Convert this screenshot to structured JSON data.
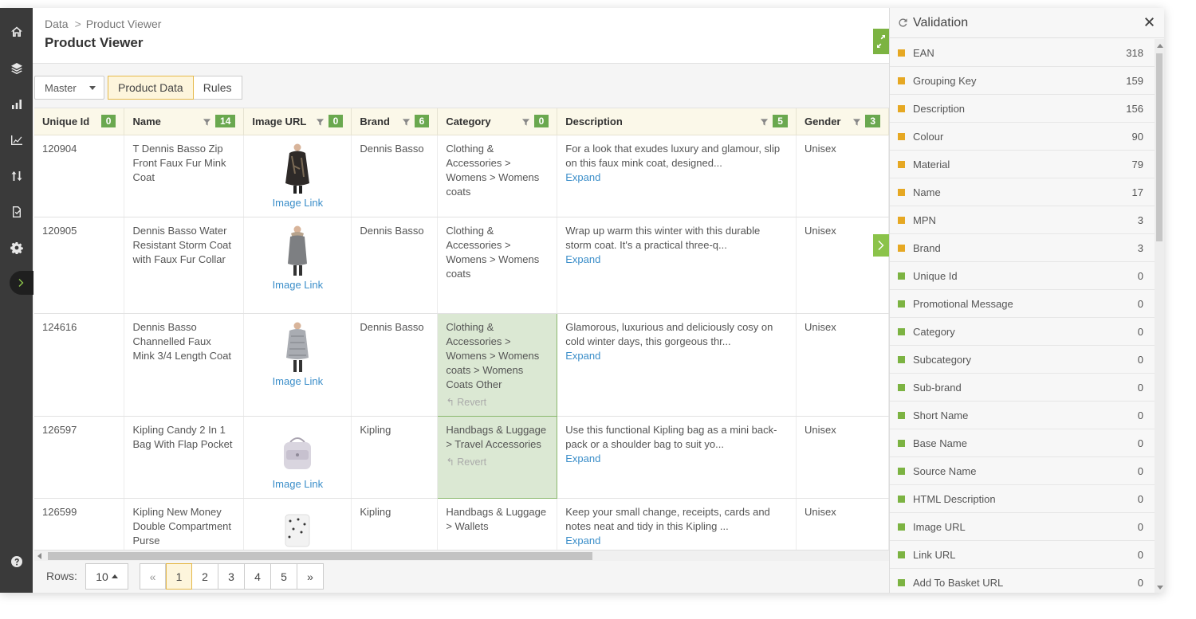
{
  "nav_icons": [
    "home-icon",
    "layers-icon",
    "bar-chart-icon",
    "area-chart-icon",
    "transfer-icon",
    "checklist-icon",
    "gear-icon",
    "chevron-right-icon",
    "help-icon"
  ],
  "breadcrumb": {
    "root": "Data",
    "separator": ">",
    "current": "Product Viewer"
  },
  "page_title": "Product Viewer",
  "toolbar": {
    "view_select": "Master",
    "tabs": [
      {
        "label": "Product Data",
        "active": true
      },
      {
        "label": "Rules",
        "active": false
      }
    ]
  },
  "grid": {
    "columns": [
      {
        "label": "Unique Id",
        "count": "0",
        "filter": false
      },
      {
        "label": "Name",
        "count": "14",
        "filter": true
      },
      {
        "label": "Image URL",
        "count": "0",
        "filter": true
      },
      {
        "label": "Brand",
        "count": "6",
        "filter": true
      },
      {
        "label": "Category",
        "count": "0",
        "filter": true
      },
      {
        "label": "Description",
        "count": "5",
        "filter": true
      },
      {
        "label": "Gender",
        "count": "3",
        "filter": true
      }
    ],
    "image_link_label": "Image Link",
    "expand_label": "Expand",
    "revert_label": "Revert",
    "rows": [
      {
        "id": "120904",
        "name": "T Dennis Basso Zip Front Faux Fur Mink Coat",
        "brand": "Dennis Basso",
        "category": "Clothing & Accessories > Womens > Womens coats",
        "category_modified": false,
        "description": "For a look that exudes luxury and glamour, slip on this faux mink coat, designed...",
        "gender": "Unisex",
        "image": "coat-dark"
      },
      {
        "id": "120905",
        "name": "Dennis Basso Water Resistant Storm Coat with Faux Fur Collar",
        "brand": "Dennis Basso",
        "category": "Clothing & Accessories > Womens > Womens coats",
        "category_modified": false,
        "description": "Wrap up warm this winter with this durable storm coat. It's a practical three-q...",
        "gender": "Unisex",
        "image": "coat-grey"
      },
      {
        "id": "124616",
        "name": "Dennis Basso Channelled Faux Mink 3/4 Length Coat",
        "brand": "Dennis Basso",
        "category": "Clothing & Accessories > Womens > Womens coats > Womens Coats Other",
        "category_modified": true,
        "description": "Glamorous, luxurious and deliciously cosy on cold winter days, this gorgeous thr...",
        "gender": "Unisex",
        "image": "coat-silver"
      },
      {
        "id": "126597",
        "name": "Kipling Candy 2 In 1 Bag With Flap Pocket",
        "brand": "Kipling",
        "category": "Handbags & Luggage > Travel Accessories",
        "category_modified": true,
        "description": "Use this functional Kipling bag as a mini back-pack or a shoulder bag to suit yo...",
        "gender": "Unisex",
        "image": "bag"
      },
      {
        "id": "126599",
        "name": "Kipling New Money Double Compartment Purse",
        "brand": "Kipling",
        "category": "Handbags & Luggage > Wallets",
        "category_modified": false,
        "description": "Keep your small change, receipts, cards and notes neat and tidy in this Kipling ...",
        "gender": "Unisex",
        "image": "purse"
      }
    ]
  },
  "footer": {
    "rows_label": "Rows:",
    "rows_value": "10",
    "pages": [
      "«",
      "1",
      "2",
      "3",
      "4",
      "5",
      "»"
    ],
    "active_page": "1"
  },
  "validation": {
    "title": "Validation",
    "colors": {
      "warning": "#e6a823",
      "ok": "#7cb342"
    },
    "items": [
      {
        "label": "EAN",
        "count": "318",
        "status": "warning"
      },
      {
        "label": "Grouping Key",
        "count": "159",
        "status": "warning"
      },
      {
        "label": "Description",
        "count": "156",
        "status": "warning"
      },
      {
        "label": "Colour",
        "count": "90",
        "status": "warning"
      },
      {
        "label": "Material",
        "count": "79",
        "status": "warning"
      },
      {
        "label": "Name",
        "count": "17",
        "status": "warning"
      },
      {
        "label": "MPN",
        "count": "3",
        "status": "warning"
      },
      {
        "label": "Brand",
        "count": "3",
        "status": "warning"
      },
      {
        "label": "Unique Id",
        "count": "0",
        "status": "ok"
      },
      {
        "label": "Promotional Message",
        "count": "0",
        "status": "ok"
      },
      {
        "label": "Category",
        "count": "0",
        "status": "ok"
      },
      {
        "label": "Subcategory",
        "count": "0",
        "status": "ok"
      },
      {
        "label": "Sub-brand",
        "count": "0",
        "status": "ok"
      },
      {
        "label": "Short Name",
        "count": "0",
        "status": "ok"
      },
      {
        "label": "Base Name",
        "count": "0",
        "status": "ok"
      },
      {
        "label": "Source Name",
        "count": "0",
        "status": "ok"
      },
      {
        "label": "HTML Description",
        "count": "0",
        "status": "ok"
      },
      {
        "label": "Image URL",
        "count": "0",
        "status": "ok"
      },
      {
        "label": "Link URL",
        "count": "0",
        "status": "ok"
      },
      {
        "label": "Add To Basket URL",
        "count": "0",
        "status": "ok"
      }
    ]
  }
}
